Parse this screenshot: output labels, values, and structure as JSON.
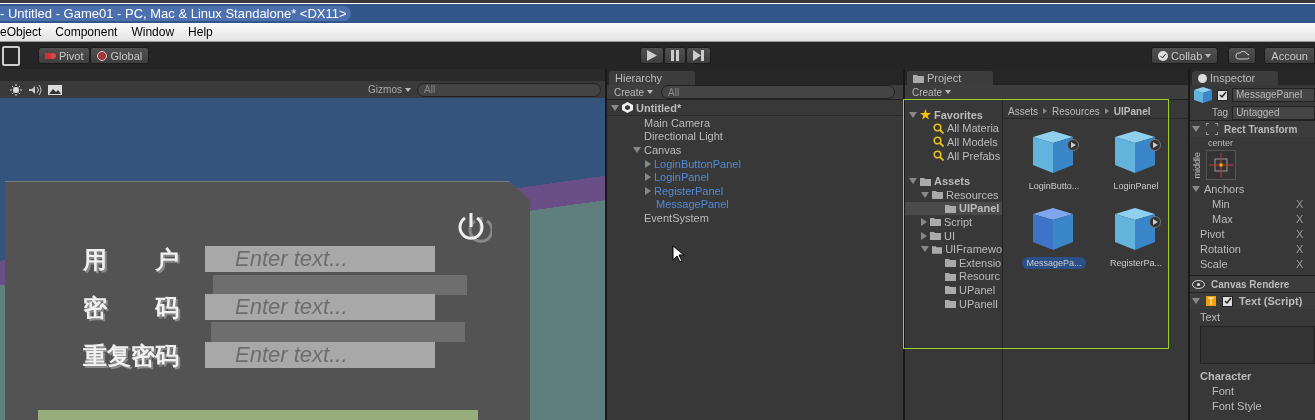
{
  "window": {
    "title": "- Untitled - Game01 - PC, Mac & Linux Standalone* <DX11>"
  },
  "menu": [
    "eObject",
    "Component",
    "Window",
    "Help"
  ],
  "toolbar": {
    "pivot": [
      {
        "label": "Pivot",
        "kind": "pivot"
      },
      {
        "label": "Global",
        "kind": "global"
      }
    ],
    "collab": "Collab",
    "account": "Accoun"
  },
  "scene": {
    "gizmos": "Gizmos",
    "search_placeholder": "All",
    "form": [
      {
        "label": "用　　户",
        "placeholder": "Enter text..."
      },
      {
        "label": "密　　码",
        "placeholder": "Enter text..."
      },
      {
        "label": "重复密码",
        "placeholder": "Enter text..."
      }
    ]
  },
  "hierarchy": {
    "tab": "Hierarchy",
    "create": "Create",
    "search_placeholder": "All",
    "scene": "Untitled*",
    "items": [
      {
        "name": "Main Camera",
        "prefab": false
      },
      {
        "name": "Directional Light",
        "prefab": false
      },
      {
        "name": "Canvas",
        "prefab": false,
        "expanded": true,
        "children": [
          {
            "name": "LoginButtonPanel",
            "prefab": true,
            "expanded": false
          },
          {
            "name": "LoginPanel",
            "prefab": true,
            "expanded": false
          },
          {
            "name": "RegisterPanel",
            "prefab": true,
            "expanded": false
          },
          {
            "name": "MessagePanel",
            "prefab": true
          }
        ]
      },
      {
        "name": "EventSystem",
        "prefab": false
      }
    ]
  },
  "project": {
    "tab": "Project",
    "create": "Create",
    "favorites_title": "Favorites",
    "favorites": [
      "All Materia",
      "All Models",
      "All Prefabs"
    ],
    "assets_title": "Assets",
    "folders": [
      {
        "name": "Resources",
        "expanded": true,
        "selected": false,
        "children": [
          {
            "name": "UIPanel",
            "selected": true
          }
        ]
      },
      {
        "name": "Script",
        "expanded": false,
        "selected": false
      },
      {
        "name": "UI",
        "expanded": false,
        "selected": false
      },
      {
        "name": "UIFramewo",
        "expanded": true,
        "selected": false,
        "children": [
          {
            "name": "Extensio",
            "selected": false
          },
          {
            "name": "Resourc",
            "selected": false
          },
          {
            "name": "UPanel",
            "selected": false
          },
          {
            "name": "UPanelI",
            "selected": false
          }
        ]
      }
    ],
    "breadcrumb": [
      "Assets",
      "Resources",
      "UIPanel"
    ],
    "assets": [
      {
        "name": "LoginButto...",
        "selected": false,
        "play": true
      },
      {
        "name": "LoginPanel",
        "selected": false,
        "play": true
      },
      {
        "name": "MessagePa...",
        "selected": true,
        "play": false
      },
      {
        "name": "RegisterPa...",
        "selected": false,
        "play": true
      }
    ]
  },
  "inspector": {
    "tab": "Inspector",
    "name": "MessagePanel",
    "active": true,
    "tag_label": "Tag",
    "tag": "Untagged",
    "rect_transform": "Rect Transform",
    "anchor_h": "center",
    "anchor_v": "middle",
    "rows": [
      {
        "label": "Anchors",
        "kind": "group"
      },
      {
        "label": "Min",
        "kind": "sub",
        "value": "X"
      },
      {
        "label": "Max",
        "kind": "sub",
        "value": "X"
      },
      {
        "label": "Pivot",
        "kind": "field",
        "value": "X"
      },
      {
        "label": "Rotation",
        "kind": "field",
        "value": "X"
      },
      {
        "label": "Scale",
        "kind": "field",
        "value": "X"
      }
    ],
    "canvas_renderer": "Canvas Rendere",
    "text_component": "Text (Script)",
    "text_enabled": true,
    "text_label": "Text",
    "character": "Character",
    "char_rows": [
      "Font",
      "Font Style"
    ]
  }
}
